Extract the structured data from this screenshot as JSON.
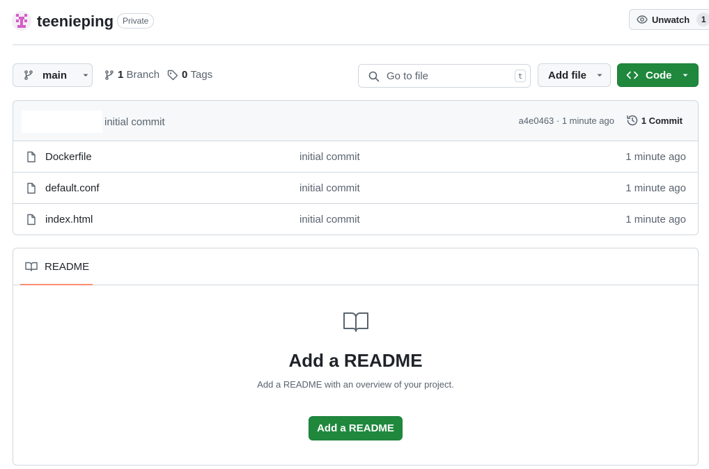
{
  "repo": {
    "name": "teenieping",
    "visibility": "Private"
  },
  "watch": {
    "label": "Unwatch",
    "count": "1"
  },
  "toolbar": {
    "branch": "main",
    "branch_count": "1",
    "branch_label": "Branch",
    "tag_count": "0",
    "tag_label": "Tags",
    "search_placeholder": "Go to file",
    "search_shortcut": "t",
    "add_file_label": "Add file",
    "code_label": "Code"
  },
  "latest_commit": {
    "message": "initial commit",
    "meta": "a4e0463 · 1 minute ago",
    "count_label": "1 Commit"
  },
  "files": [
    {
      "name": "Dockerfile",
      "message": "initial commit",
      "age": "1 minute ago"
    },
    {
      "name": "default.conf",
      "message": "initial commit",
      "age": "1 minute ago"
    },
    {
      "name": "index.html",
      "message": "initial commit",
      "age": "1 minute ago"
    }
  ],
  "readme": {
    "tab_label": "README",
    "title": "Add a README",
    "subtitle": "Add a README with an overview of your project.",
    "button_label": "Add a README"
  },
  "colors": {
    "primary_green": "#1f883d",
    "tab_underline": "#fd8c73",
    "border": "#d0d7de",
    "muted_text": "#59636e"
  },
  "icons": [
    "avatar-identicon",
    "eye-icon",
    "git-branch-icon",
    "caret-down-icon",
    "tag-icon",
    "search-icon",
    "code-icon",
    "history-icon",
    "file-icon",
    "book-icon"
  ]
}
